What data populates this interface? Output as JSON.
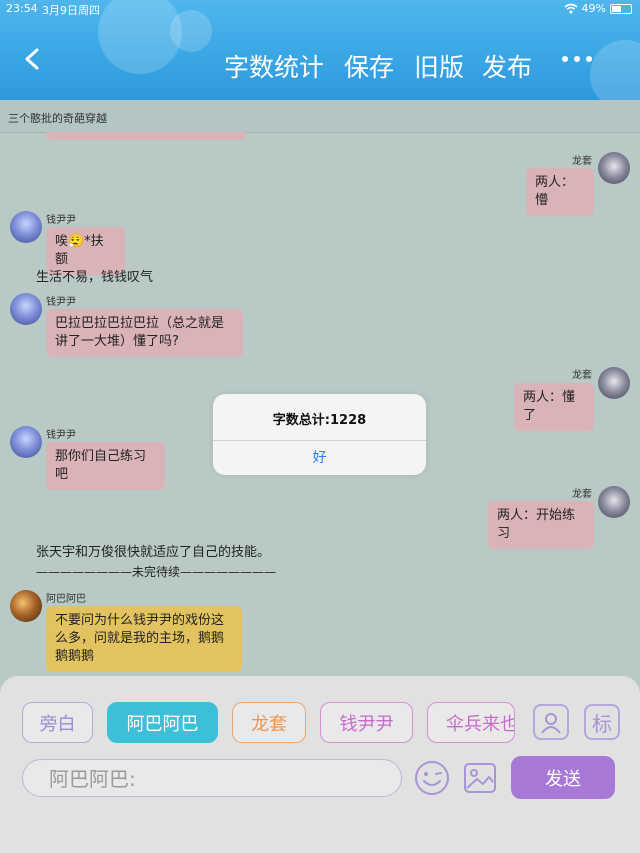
{
  "status_bar": {
    "time": "23:54",
    "date": "3月9日周四",
    "battery": "49%",
    "battery_level": 0.49
  },
  "header": {
    "back_label": "返回",
    "menu": [
      "字数统计",
      "保存",
      "旧版",
      "发布"
    ]
  },
  "story_title": "三个憨批的奇葩穿越",
  "messages": [
    {
      "speaker": "龙套",
      "text": "两人：懵"
    },
    {
      "speaker": "钱尹尹",
      "text": "唉😮‍💨*扶额"
    },
    {
      "narration": "生活不易，钱钱叹气"
    },
    {
      "speaker": "钱尹尹",
      "text": "巴拉巴拉巴拉巴拉（总之就是讲了一大堆）懂了吗?"
    },
    {
      "speaker": "龙套",
      "text": "两人：懂了"
    },
    {
      "speaker": "钱尹尹",
      "text": "那你们自己练习吧"
    },
    {
      "speaker": "龙套",
      "text": "两人：开始练习"
    },
    {
      "narration": "张天宇和万俊很快就适应了自己的技能。"
    },
    {
      "narration": "————————未完待续————————"
    },
    {
      "speaker": "阿巴阿巴",
      "text": "不要问为什么钱尹尹的戏份这么多，问就是我的主场，鹅鹅鹅鹅鹅"
    }
  ],
  "dialog": {
    "title": "字数总计:1228",
    "ok": "好"
  },
  "roles": [
    "旁白",
    "阿巴阿巴",
    "龙套",
    "钱尹尹",
    "伞兵来也"
  ],
  "mark_label": "标",
  "input": {
    "placeholder": "阿巴阿巴:"
  },
  "send_label": "发送",
  "colors": {
    "header": "#3aa7e5",
    "selected_role": "#3dbfd8",
    "send": "#a878d6",
    "bubble_pink": "#d9b3b8",
    "bubble_yellow": "#e3c35f"
  }
}
